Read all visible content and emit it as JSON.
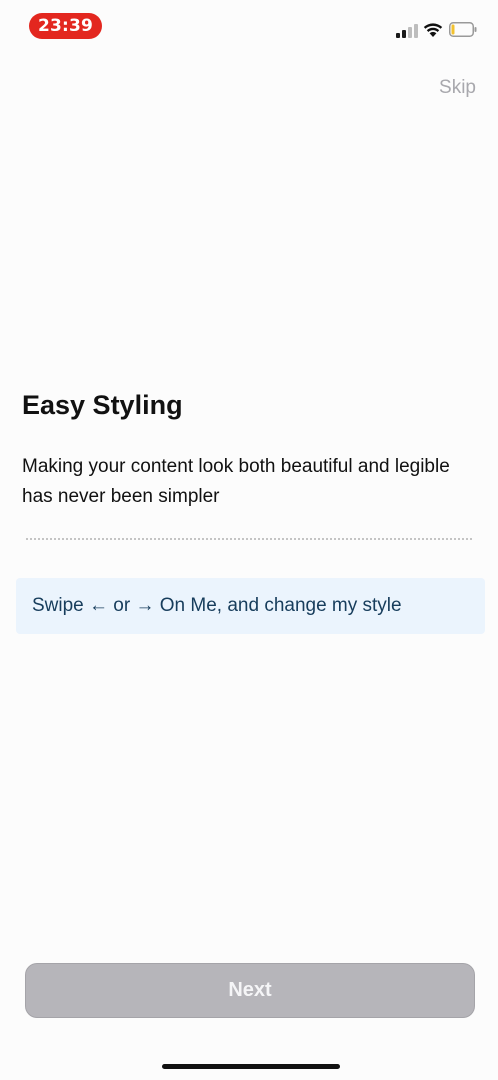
{
  "status_bar": {
    "time": "23:39",
    "time_pill_color": "#e3271f",
    "icons": [
      "signal-icon",
      "wifi-icon",
      "battery-icon"
    ],
    "signal_bars_filled": 2,
    "signal_bars_total": 4,
    "battery_level_percent": 10,
    "battery_color": "#f2c230"
  },
  "header": {
    "skip_label": "Skip"
  },
  "main": {
    "title": "Easy Styling",
    "description": "Making your content look both beautiful and legible has never been simpler",
    "hint_text": "Swipe ← or → On Me, and change my style",
    "hint_background": "#ebf4fd"
  },
  "footer": {
    "next_label": "Next",
    "next_button_color": "#b6b5ba"
  }
}
